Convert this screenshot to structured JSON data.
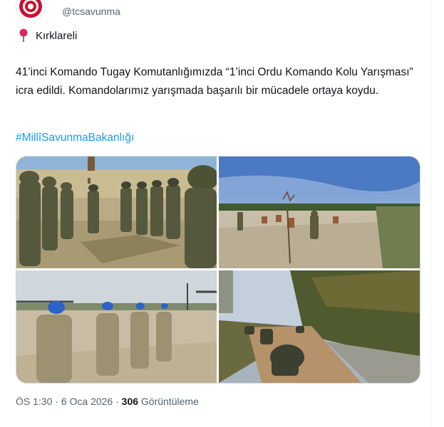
{
  "account": {
    "handle": "@tcsavunma",
    "avatar_icon": "ministry-seal-icon",
    "more_icon": "more-dots-icon"
  },
  "tweet": {
    "location_icon": "red-pin-icon",
    "location": "Kırklareli",
    "text": "41’inci Komando Tugay Komutanlığımızda “1’inci Ordu Komando Kolu Yarışması” icra edildi. Komandolarımız yarışmada başarılı bir mücadele ortaya koydu.",
    "hashtag": "#MillîSavunmaBakanlığı"
  },
  "meta": {
    "time": "ÖS 1:30",
    "separator": "·",
    "date": "6 Oca 2026",
    "views_count": "306",
    "views_label": "Görüntüleme"
  },
  "colors": {
    "link": "#1d9bf0",
    "secondary_text": "#536471",
    "border": "#cfd9de"
  }
}
